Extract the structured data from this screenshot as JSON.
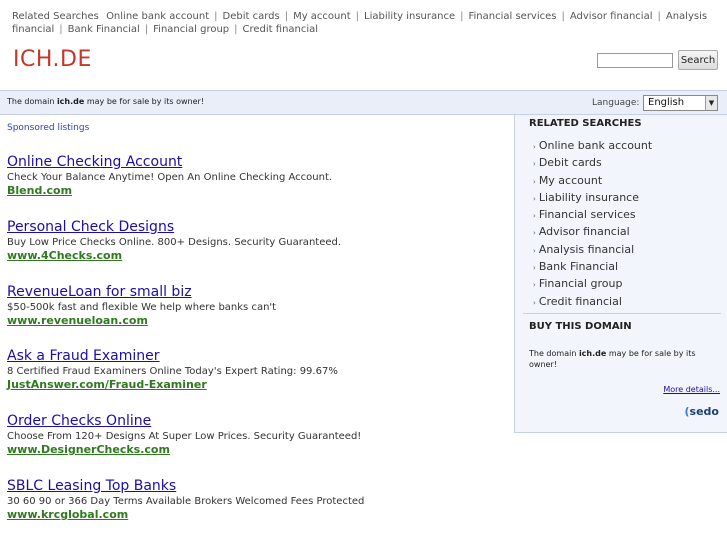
{
  "top_links": {
    "lead": "Related Searches",
    "items": [
      "Online bank account",
      "Debit cards",
      "My account",
      "Liability insurance",
      "Financial services",
      "Advisor financial",
      "Analysis financial",
      "Bank Financial",
      "Financial group",
      "Credit financial"
    ]
  },
  "logo": "ICH.DE",
  "search": {
    "value": "",
    "placeholder": "",
    "button_label": "Search"
  },
  "notice": {
    "prefix": "The domain ",
    "domain": "ich.de",
    "suffix": " may be for sale by its owner!"
  },
  "language": {
    "label": "Language:",
    "selected": "English",
    "arrow_icon": "chevron-down-icon"
  },
  "sponsored_label": "Sponsored listings",
  "listings": [
    {
      "title": "Online Checking Account",
      "desc": "Check Your Balance Anytime! Open An Online Checking Account.",
      "url": "Blend.com"
    },
    {
      "title": "Personal Check Designs",
      "desc": "Buy Low Price Checks Online. 800+ Designs. Security Guaranteed.",
      "url": "www.4Checks.com"
    },
    {
      "title": "RevenueLoan for small biz",
      "desc": "$50-500k fast and flexible We help where banks can't",
      "url": "www.revenueloan.com"
    },
    {
      "title": "Ask a Fraud Examiner",
      "desc": "8 Certified Fraud Examiners Online Today's Expert Rating: 99.67%",
      "url": "JustAnswer.com/Fraud-Examiner"
    },
    {
      "title": "Order Checks Online",
      "desc": "Choose From 120+ Designs At Super Low Prices. Security Guaranteed!",
      "url": "www.DesignerChecks.com"
    },
    {
      "title": "SBLC Leasing Top Banks",
      "desc": "30 60 90 or 366 Day Terms Available Brokers Welcomed Fees Protected",
      "url": "www.krcglobal.com"
    }
  ],
  "sidebar": {
    "related_heading": "RELATED SEARCHES",
    "related": [
      "Online bank account",
      "Debit cards",
      "My account",
      "Liability insurance",
      "Financial services",
      "Advisor financial",
      "Analysis financial",
      "Bank Financial",
      "Financial group",
      "Credit financial"
    ],
    "buy_heading": "BUY THIS DOMAIN",
    "buy_prefix": "The domain ",
    "buy_domain": "ich.de",
    "buy_suffix": " may be for sale by its owner!",
    "more_details": "More details...",
    "sedo_logo": "sedo"
  },
  "colors": {
    "logo": "#c0392b",
    "link": "#1a0dab",
    "url": "#2f7a1f",
    "notice_bg": "#e9eef8"
  }
}
